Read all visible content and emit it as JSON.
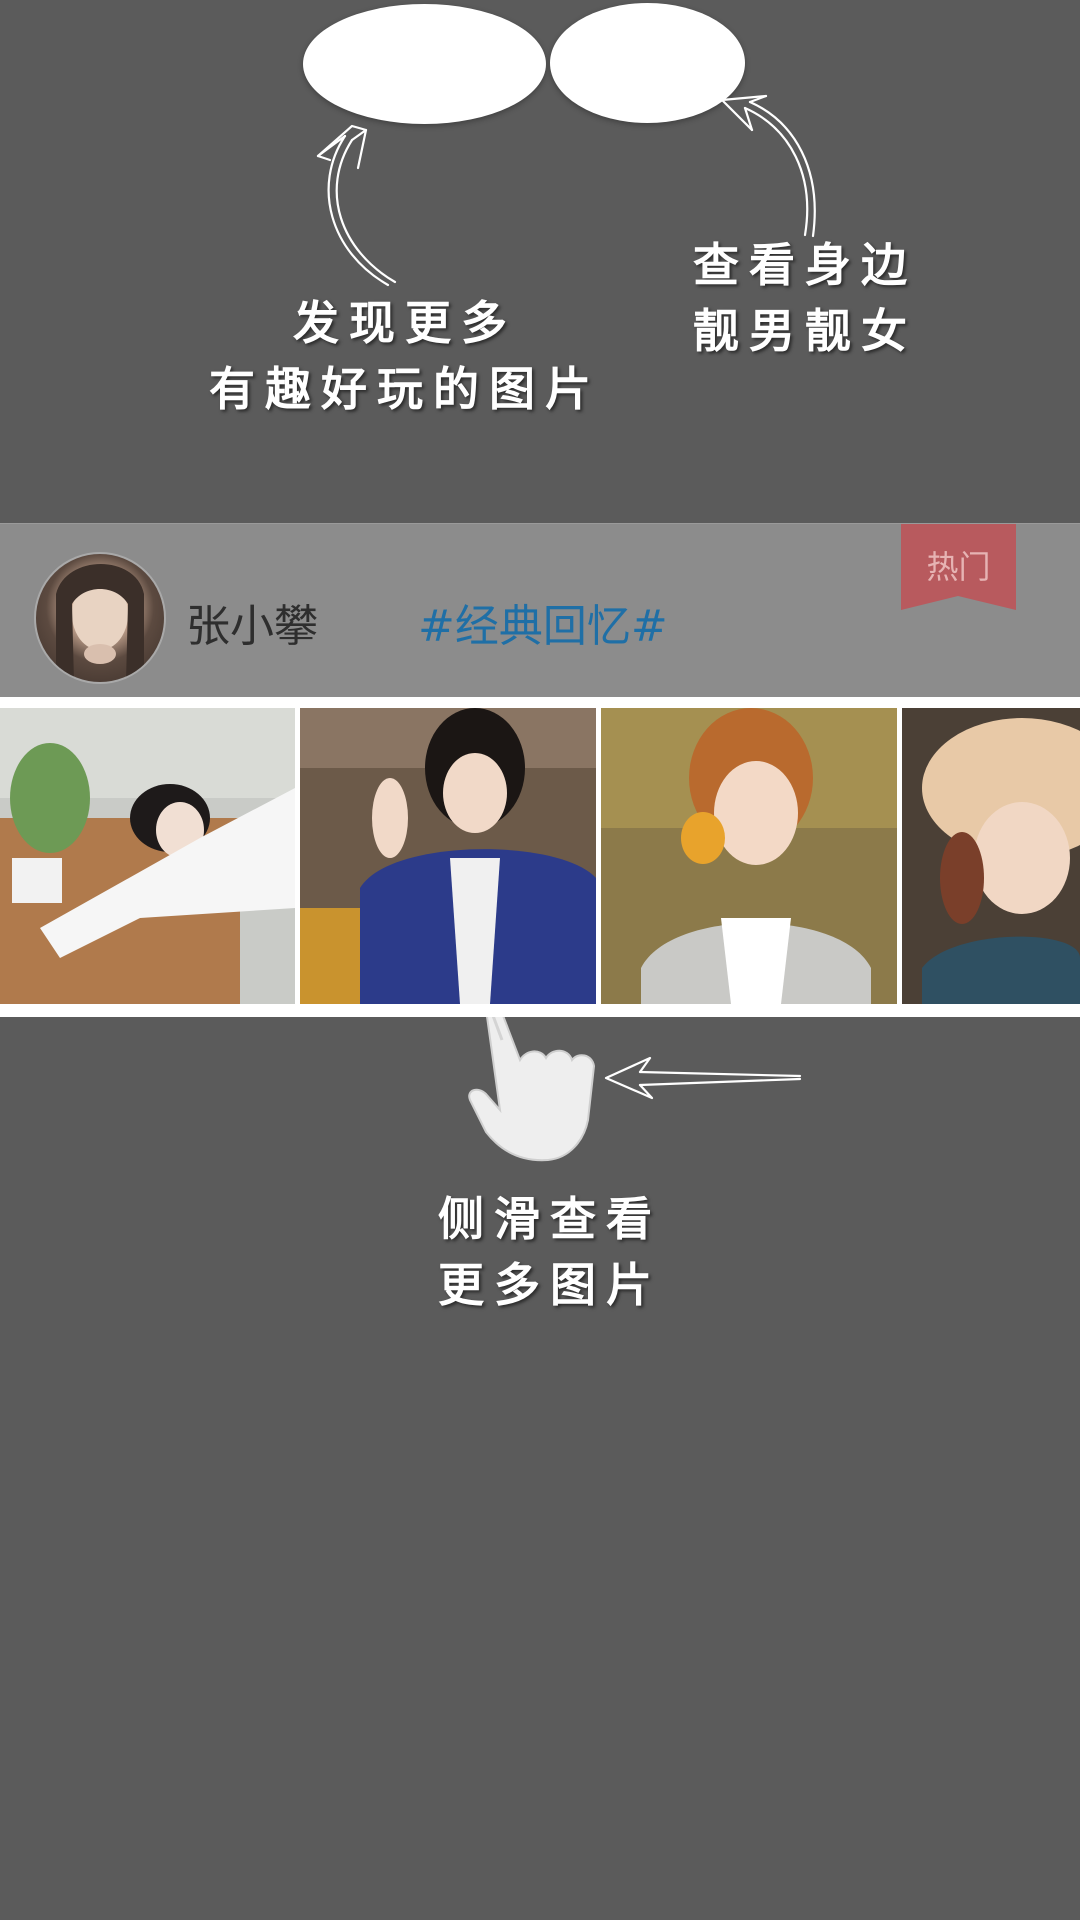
{
  "guide": {
    "discover_hint": [
      "发现更多",
      "有趣好玩的图片"
    ],
    "nearby_hint": [
      "查看身边",
      "靓男靓女"
    ],
    "swipe_hint": [
      "侧滑查看",
      "更多图片"
    ]
  },
  "post": {
    "username": "张小攀",
    "topic": "#经典回忆#",
    "badge": "热门",
    "photo_count_visible": 4
  },
  "colors": {
    "overlay": "#5b5b5b",
    "header": "#8c8c8c",
    "topic": "#1f6fa6",
    "badge": "#b85a5e"
  }
}
